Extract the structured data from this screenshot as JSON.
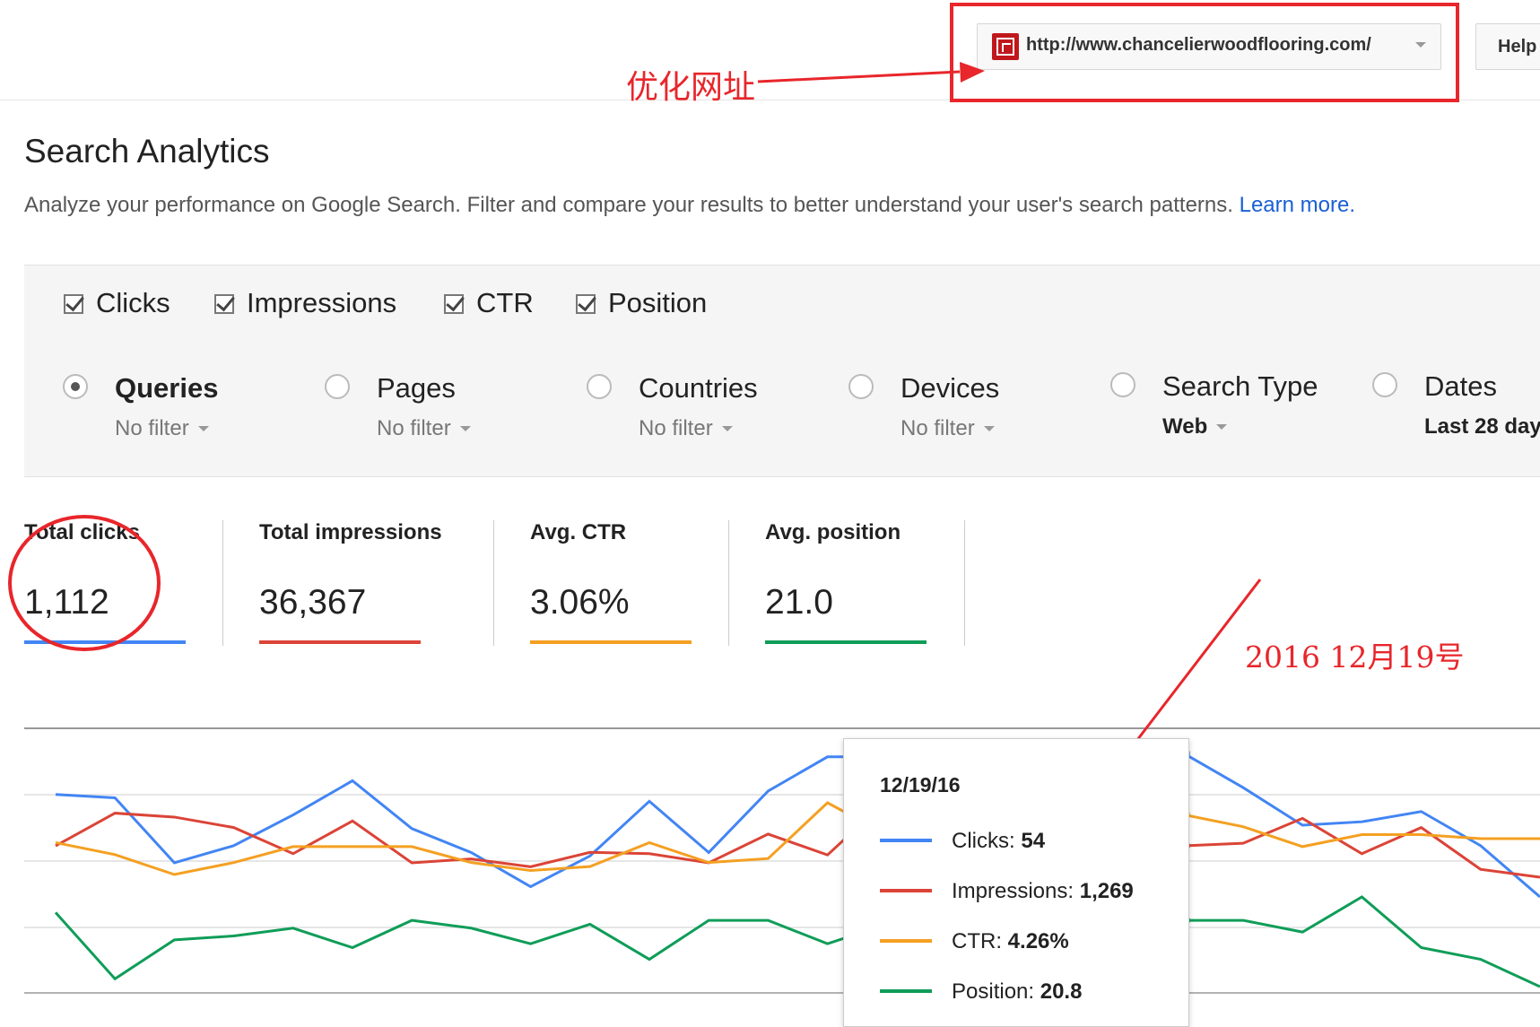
{
  "header": {
    "site_url": "http://www.chancelierwoodflooring.com/",
    "help_label": "Help",
    "annotation_url": "优化网址"
  },
  "page": {
    "title": "Search Analytics",
    "description": "Analyze your performance on Google Search. Filter and compare your results to better understand your user's search patterns.",
    "learn_more": "Learn more."
  },
  "metrics": {
    "items": [
      {
        "label": "Clicks",
        "checked": true
      },
      {
        "label": "Impressions",
        "checked": true
      },
      {
        "label": "CTR",
        "checked": true
      },
      {
        "label": "Position",
        "checked": true
      }
    ]
  },
  "dimensions": {
    "items": [
      {
        "label": "Queries",
        "filter": "No filter",
        "selected": true
      },
      {
        "label": "Pages",
        "filter": "No filter",
        "selected": false
      },
      {
        "label": "Countries",
        "filter": "No filter",
        "selected": false
      },
      {
        "label": "Devices",
        "filter": "No filter",
        "selected": false
      },
      {
        "label": "Search Type",
        "filter": "Web",
        "selected": false
      },
      {
        "label": "Dates",
        "filter": "Last 28 days",
        "selected": false
      }
    ]
  },
  "totals": {
    "items": [
      {
        "label": "Total clicks",
        "value": "1,112",
        "color": "#4285f4"
      },
      {
        "label": "Total impressions",
        "value": "36,367",
        "color": "#db4437"
      },
      {
        "label": "Avg. CTR",
        "value": "3.06%",
        "color": "#f4a022"
      },
      {
        "label": "Avg. position",
        "value": "21.0",
        "color": "#0f9d58"
      }
    ]
  },
  "annotation_date": "2016 12月19号",
  "tooltip": {
    "date": "12/19/16",
    "rows": [
      {
        "label": "Clicks: ",
        "value": "54",
        "color": "#4285f4"
      },
      {
        "label": "Impressions: ",
        "value": "1,269",
        "color": "#db4437"
      },
      {
        "label": "CTR: ",
        "value": "4.26%",
        "color": "#f4a022"
      },
      {
        "label": "Position: ",
        "value": "20.8",
        "color": "#0f9d58"
      }
    ]
  },
  "chart_data": {
    "type": "line",
    "x": [
      1,
      2,
      3,
      4,
      5,
      6,
      7,
      8,
      9,
      10,
      11,
      12,
      13,
      14,
      15,
      16,
      17,
      18,
      19,
      20,
      21,
      22,
      23,
      24,
      25,
      26
    ],
    "series": [
      {
        "name": "Clicks",
        "color": "#4285f4",
        "values": [
          42,
          41,
          22,
          27,
          36,
          46,
          32,
          25,
          15,
          24,
          40,
          25,
          43,
          53,
          53,
          50,
          40,
          35,
          22,
          54,
          44,
          33,
          34,
          37,
          27,
          12
        ]
      },
      {
        "name": "Impressions",
        "color": "#db4437",
        "values": [
          1090,
          1215,
          1200,
          1160,
          1060,
          1185,
          1025,
          1040,
          1010,
          1065,
          1060,
          1025,
          1135,
          1055,
          1265,
          1100,
          1060,
          1220,
          1190,
          1090,
          1100,
          1195,
          1060,
          1160,
          1000,
          970
        ]
      },
      {
        "name": "CTR",
        "color": "#f4a022",
        "values": [
          3.4,
          3.1,
          2.6,
          2.9,
          3.3,
          3.3,
          3.3,
          2.9,
          2.7,
          2.8,
          3.4,
          2.9,
          3.0,
          4.4,
          3.6,
          3.8,
          3.5,
          3.6,
          3.6,
          4.1,
          3.8,
          3.3,
          3.6,
          3.6,
          3.5,
          3.5
        ]
      },
      {
        "name": "Position",
        "color": "#0f9d58",
        "values": [
          20.6,
          22.3,
          21.3,
          21.2,
          21.0,
          21.5,
          20.8,
          21.0,
          21.4,
          20.9,
          21.8,
          20.8,
          20.8,
          21.4,
          20.9,
          21.3,
          21.0,
          21.4,
          20.8,
          20.8,
          20.8,
          21.1,
          20.2,
          21.5,
          21.8,
          22.5
        ]
      }
    ],
    "highlight_index": 19,
    "grid": true
  }
}
